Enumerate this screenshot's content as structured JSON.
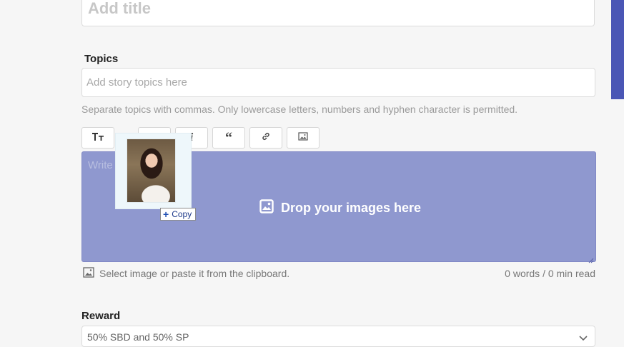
{
  "title": {
    "placeholder": "Add title"
  },
  "topics": {
    "label": "Topics",
    "placeholder": "Add story topics here",
    "helper": "Separate topics with commas. Only lowercase letters, numbers and hyphen character is permitted."
  },
  "toolbar": {
    "buttons": [
      {
        "icon": "text-size-icon"
      },
      {
        "icon": "bold-icon"
      },
      {
        "icon": "italic-icon"
      },
      {
        "icon": "quote-icon"
      },
      {
        "icon": "link-icon"
      },
      {
        "icon": "image-icon"
      }
    ]
  },
  "editor": {
    "placeholder": "Write",
    "drop_message": "Drop your images here"
  },
  "footer": {
    "select_text": "Select image or paste it from the clipboard.",
    "stats": "0 words / 0 min read"
  },
  "reward": {
    "label": "Reward",
    "value": "50% SBD and 50% SP"
  },
  "drag": {
    "copy_label": "Copy"
  },
  "colors": {
    "accent": "#4a56b5",
    "dropzone": "#8f98cf"
  }
}
